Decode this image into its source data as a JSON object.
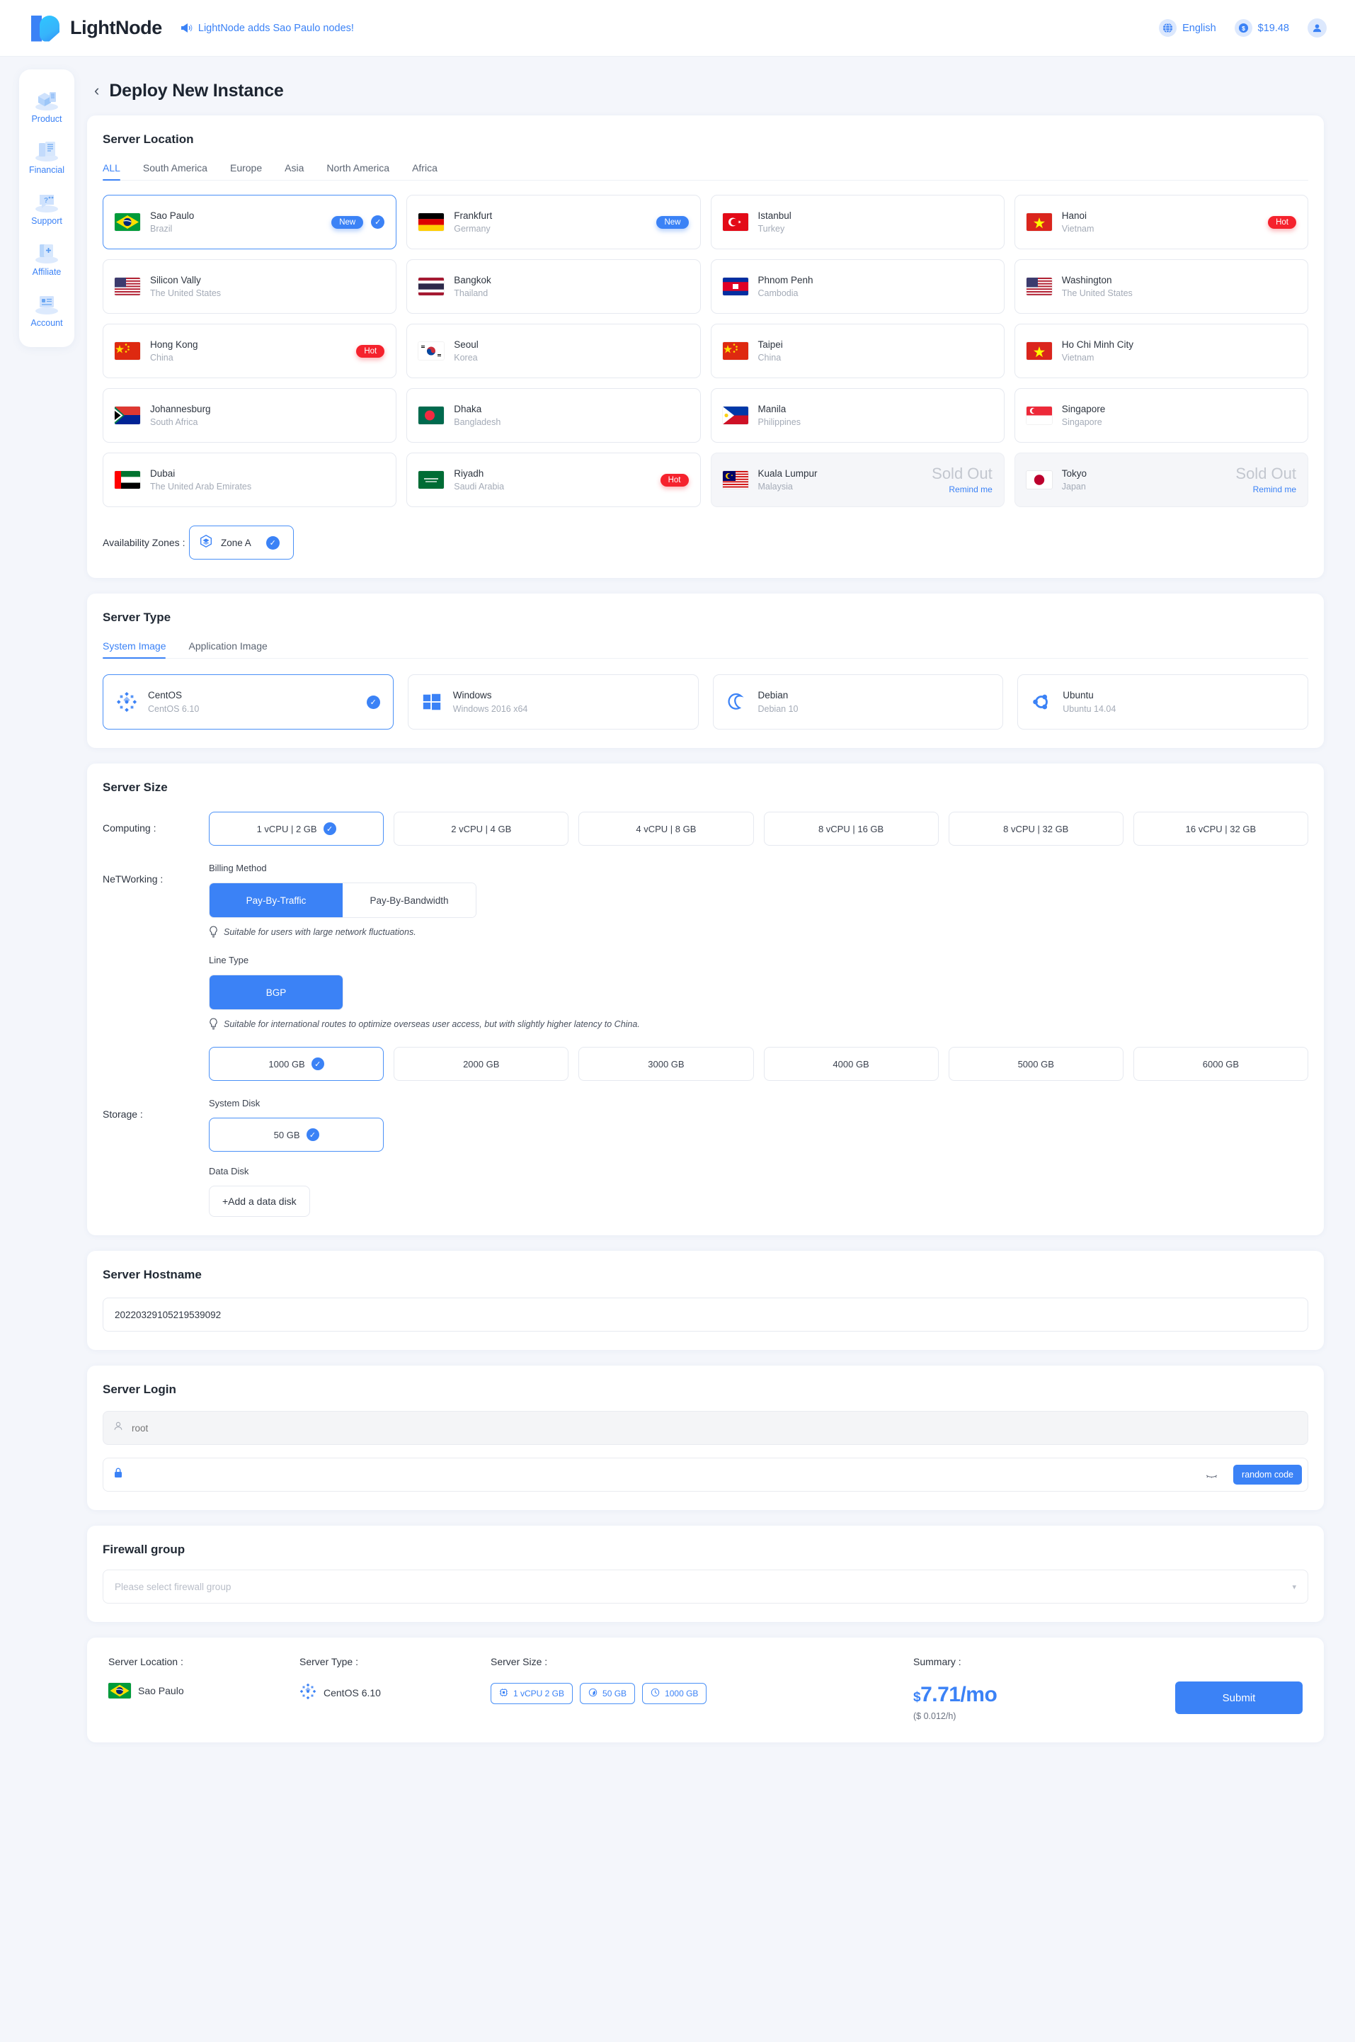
{
  "header": {
    "brand": "LightNode",
    "promo": "LightNode adds Sao Paulo nodes!",
    "language": "English",
    "balance": "$19.48"
  },
  "sidebar": {
    "items": [
      {
        "label": "Product",
        "icon": "product-icon"
      },
      {
        "label": "Financial",
        "icon": "financial-icon"
      },
      {
        "label": "Support",
        "icon": "support-icon"
      },
      {
        "label": "Affiliate",
        "icon": "affiliate-icon"
      },
      {
        "label": "Account",
        "icon": "account-icon"
      }
    ]
  },
  "page": {
    "title": "Deploy New Instance"
  },
  "server_location": {
    "title": "Server Location",
    "tabs": [
      "ALL",
      "South America",
      "Europe",
      "Asia",
      "North America",
      "Africa"
    ],
    "active_tab": "ALL",
    "locations": [
      {
        "city": "Sao Paulo",
        "country": "Brazil",
        "flag": "br",
        "badge": "New",
        "badge_type": "new",
        "selected": true,
        "sold_out": false
      },
      {
        "city": "Frankfurt",
        "country": "Germany",
        "flag": "de",
        "badge": "New",
        "badge_type": "new",
        "selected": false,
        "sold_out": false
      },
      {
        "city": "Istanbul",
        "country": "Turkey",
        "flag": "tr",
        "badge": "",
        "badge_type": "",
        "selected": false,
        "sold_out": false
      },
      {
        "city": "Hanoi",
        "country": "Vietnam",
        "flag": "vn",
        "badge": "Hot",
        "badge_type": "hot",
        "selected": false,
        "sold_out": false
      },
      {
        "city": "Silicon Vally",
        "country": "The United States",
        "flag": "us",
        "badge": "",
        "badge_type": "",
        "selected": false,
        "sold_out": false
      },
      {
        "city": "Bangkok",
        "country": "Thailand",
        "flag": "th",
        "badge": "",
        "badge_type": "",
        "selected": false,
        "sold_out": false
      },
      {
        "city": "Phnom Penh",
        "country": "Cambodia",
        "flag": "kh",
        "badge": "",
        "badge_type": "",
        "selected": false,
        "sold_out": false
      },
      {
        "city": "Washington",
        "country": "The United States",
        "flag": "us",
        "badge": "",
        "badge_type": "",
        "selected": false,
        "sold_out": false
      },
      {
        "city": "Hong Kong",
        "country": "China",
        "flag": "cn",
        "badge": "Hot",
        "badge_type": "hot",
        "selected": false,
        "sold_out": false
      },
      {
        "city": "Seoul",
        "country": "Korea",
        "flag": "kr",
        "badge": "",
        "badge_type": "",
        "selected": false,
        "sold_out": false
      },
      {
        "city": "Taipei",
        "country": "China",
        "flag": "cn",
        "badge": "",
        "badge_type": "",
        "selected": false,
        "sold_out": false
      },
      {
        "city": "Ho Chi Minh City",
        "country": "Vietnam",
        "flag": "vn",
        "badge": "",
        "badge_type": "",
        "selected": false,
        "sold_out": false
      },
      {
        "city": "Johannesburg",
        "country": "South Africa",
        "flag": "za",
        "badge": "",
        "badge_type": "",
        "selected": false,
        "sold_out": false
      },
      {
        "city": "Dhaka",
        "country": "Bangladesh",
        "flag": "bd",
        "badge": "",
        "badge_type": "",
        "selected": false,
        "sold_out": false
      },
      {
        "city": "Manila",
        "country": "Philippines",
        "flag": "ph",
        "badge": "",
        "badge_type": "",
        "selected": false,
        "sold_out": false
      },
      {
        "city": "Singapore",
        "country": "Singapore",
        "flag": "sg",
        "badge": "",
        "badge_type": "",
        "selected": false,
        "sold_out": false
      },
      {
        "city": "Dubai",
        "country": "The United Arab Emirates",
        "flag": "ae",
        "badge": "",
        "badge_type": "",
        "selected": false,
        "sold_out": false
      },
      {
        "city": "Riyadh",
        "country": "Saudi Arabia",
        "flag": "sa",
        "badge": "Hot",
        "badge_type": "hot",
        "selected": false,
        "sold_out": false
      },
      {
        "city": "Kuala Lumpur",
        "country": "Malaysia",
        "flag": "my",
        "badge": "",
        "badge_type": "",
        "selected": false,
        "sold_out": true,
        "sold_text": "Sold Out",
        "remind": "Remind me"
      },
      {
        "city": "Tokyo",
        "country": "Japan",
        "flag": "jp",
        "badge": "",
        "badge_type": "",
        "selected": false,
        "sold_out": true,
        "sold_text": "Sold Out",
        "remind": "Remind me"
      }
    ],
    "availability_zones_label": "Availability Zones :",
    "zone": {
      "label": "Zone A",
      "selected": true
    }
  },
  "server_type": {
    "title": "Server Type",
    "tabs": [
      "System Image",
      "Application Image"
    ],
    "active_tab": "System Image",
    "images": [
      {
        "name": "CentOS",
        "version": "CentOS 6.10",
        "icon": "centos-icon",
        "selected": true
      },
      {
        "name": "Windows",
        "version": "Windows 2016 x64",
        "icon": "windows-icon",
        "selected": false
      },
      {
        "name": "Debian",
        "version": "Debian 10",
        "icon": "debian-icon",
        "selected": false
      },
      {
        "name": "Ubuntu",
        "version": "Ubuntu 14.04",
        "icon": "ubuntu-icon",
        "selected": false
      }
    ]
  },
  "server_size": {
    "title": "Server Size",
    "computing_label": "Computing :",
    "computing_options": [
      {
        "label": "1 vCPU | 2 GB",
        "selected": true
      },
      {
        "label": "2 vCPU | 4 GB",
        "selected": false
      },
      {
        "label": "4 vCPU | 8 GB",
        "selected": false
      },
      {
        "label": "8 vCPU | 16 GB",
        "selected": false
      },
      {
        "label": "8 vCPU | 32 GB",
        "selected": false
      },
      {
        "label": "16 vCPU | 32 GB",
        "selected": false
      }
    ],
    "networking_label": "NeTWorking :",
    "billing_method_label": "Billing Method",
    "billing_options": [
      {
        "label": "Pay-By-Traffic",
        "selected": true
      },
      {
        "label": "Pay-By-Bandwidth",
        "selected": false
      }
    ],
    "billing_hint": "Suitable for users with large network fluctuations.",
    "line_type_label": "Line Type",
    "line_options": [
      {
        "label": "BGP",
        "selected": true
      }
    ],
    "line_hint": "Suitable for international routes to optimize overseas user access, but with slightly higher latency to China.",
    "traffic_options": [
      {
        "label": "1000 GB",
        "selected": true
      },
      {
        "label": "2000 GB",
        "selected": false
      },
      {
        "label": "3000 GB",
        "selected": false
      },
      {
        "label": "4000 GB",
        "selected": false
      },
      {
        "label": "5000 GB",
        "selected": false
      },
      {
        "label": "6000 GB",
        "selected": false
      }
    ],
    "storage_label": "Storage :",
    "system_disk_label": "System Disk",
    "system_disk_options": [
      {
        "label": "50 GB",
        "selected": true
      }
    ],
    "data_disk_label": "Data Disk",
    "add_data_disk": "+Add a data disk"
  },
  "server_hostname": {
    "title": "Server Hostname",
    "value": "20220329105219539092"
  },
  "server_login": {
    "title": "Server Login",
    "username_placeholder": "root",
    "password_value": "",
    "random_code_button": "random code"
  },
  "firewall": {
    "title": "Firewall group",
    "placeholder": "Please select firewall group"
  },
  "summary": {
    "location_label": "Server Location :",
    "location_value": "Sao Paulo",
    "location_flag": "br",
    "type_label": "Server Type :",
    "type_value": "CentOS 6.10",
    "size_label": "Server Size :",
    "size_chips": [
      {
        "label": "1 vCPU 2 GB",
        "icon": "cpu-icon"
      },
      {
        "label": "50 GB",
        "icon": "disk-icon"
      },
      {
        "label": "1000 GB",
        "icon": "traffic-icon"
      }
    ],
    "summary_label": "Summary :",
    "price_currency": "$",
    "price_value": "7.71/mo",
    "price_hourly": "($ 0.012/h)",
    "submit_label": "Submit"
  },
  "colors": {
    "accent": "#3b82f6",
    "hot": "#f5222d",
    "page_bg": "#f4f6fb"
  }
}
